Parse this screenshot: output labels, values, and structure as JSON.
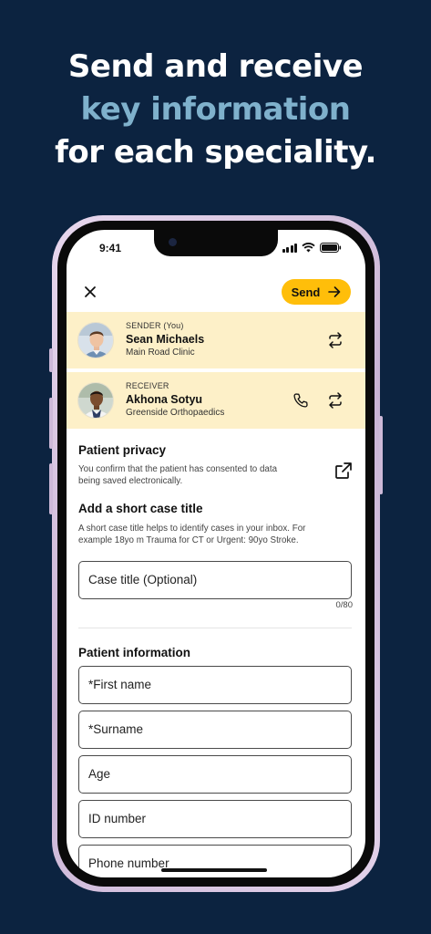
{
  "headline": {
    "line1": "Send and receive",
    "line2": "key information",
    "line3": "for each speciality."
  },
  "status_bar": {
    "time": "9:41"
  },
  "toolbar": {
    "close_icon": "close-icon",
    "send_label": "Send"
  },
  "sender": {
    "role": "SENDER (You)",
    "name": "Sean Michaels",
    "clinic": "Main Road Clinic"
  },
  "receiver": {
    "role": "RECEIVER",
    "name": "Akhona Sotyu",
    "clinic": "Greenside Orthopaedics"
  },
  "privacy": {
    "title": "Patient privacy",
    "text_line1": "You confirm that the patient has consented to data",
    "text_line2": "being saved electronically."
  },
  "case_title": {
    "title": "Add a short case title",
    "text_line1": "A short case title helps to identify cases in your inbox. For",
    "text_line2": "example 18yo m Trauma for CT or Urgent: 90yo Stroke.",
    "placeholder": "Case title (Optional)",
    "counter": "0/80"
  },
  "patient_info": {
    "title": "Patient information",
    "first_name": "*First name",
    "surname": "*Surname",
    "age": "Age",
    "id_number": "ID number",
    "phone_number": "Phone number"
  },
  "colors": {
    "background": "#0c2340",
    "accent": "#ffbe0a",
    "card": "#fdf0c8",
    "headline_highlight": "#7fb1cc"
  }
}
